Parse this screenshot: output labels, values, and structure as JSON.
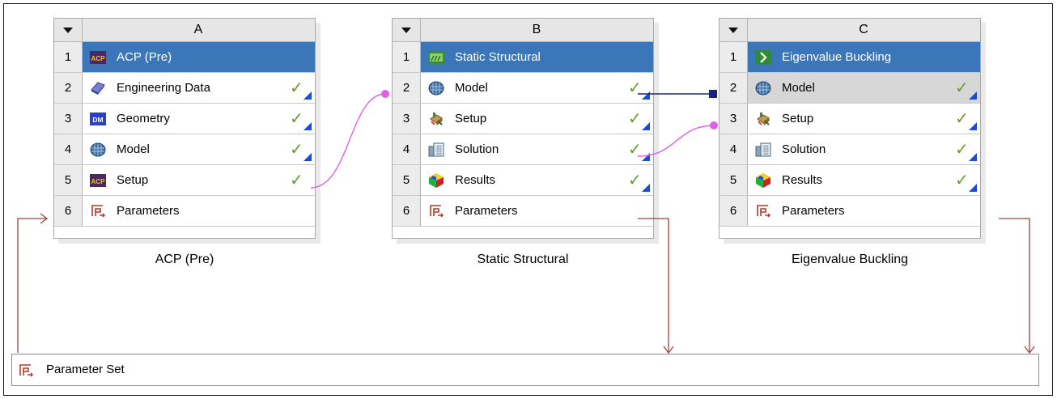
{
  "systems": [
    {
      "letter": "A",
      "name": "ACP (Pre)",
      "rows": [
        {
          "num": "1",
          "icon": "acp-icon",
          "label": "ACP (Pre)",
          "check": "",
          "triangle": false,
          "state": "selected"
        },
        {
          "num": "2",
          "icon": "engineering-data-icon",
          "label": "Engineering Data",
          "check": "✓",
          "triangle": true,
          "state": ""
        },
        {
          "num": "3",
          "icon": "geometry-dm-icon",
          "label": "Geometry",
          "check": "✓",
          "triangle": true,
          "state": ""
        },
        {
          "num": "4",
          "icon": "model-icon",
          "label": "Model",
          "check": "✓",
          "triangle": true,
          "state": ""
        },
        {
          "num": "5",
          "icon": "acp-icon",
          "label": "Setup",
          "check": "✓",
          "triangle": false,
          "state": ""
        },
        {
          "num": "6",
          "icon": "parameters-icon",
          "label": "Parameters",
          "check": "",
          "triangle": false,
          "state": ""
        }
      ]
    },
    {
      "letter": "B",
      "name": "Static Structural",
      "rows": [
        {
          "num": "1",
          "icon": "static-structural-icon",
          "label": "Static Structural",
          "check": "",
          "triangle": false,
          "state": "selected"
        },
        {
          "num": "2",
          "icon": "model-icon",
          "label": "Model",
          "check": "✓",
          "triangle": true,
          "state": ""
        },
        {
          "num": "3",
          "icon": "setup-icon",
          "label": "Setup",
          "check": "✓",
          "triangle": true,
          "state": ""
        },
        {
          "num": "4",
          "icon": "solution-icon",
          "label": "Solution",
          "check": "✓",
          "triangle": true,
          "state": ""
        },
        {
          "num": "5",
          "icon": "results-icon",
          "label": "Results",
          "check": "✓",
          "triangle": true,
          "state": ""
        },
        {
          "num": "6",
          "icon": "parameters-icon",
          "label": "Parameters",
          "check": "",
          "triangle": false,
          "state": ""
        }
      ]
    },
    {
      "letter": "C",
      "name": "Eigenvalue Buckling",
      "rows": [
        {
          "num": "1",
          "icon": "eigenvalue-buckling-icon",
          "label": "Eigenvalue Buckling",
          "check": "",
          "triangle": false,
          "state": "selected"
        },
        {
          "num": "2",
          "icon": "model-icon",
          "label": "Model",
          "check": "✓",
          "triangle": true,
          "state": "shared"
        },
        {
          "num": "3",
          "icon": "setup-icon",
          "label": "Setup",
          "check": "✓",
          "triangle": true,
          "state": ""
        },
        {
          "num": "4",
          "icon": "solution-icon",
          "label": "Solution",
          "check": "✓",
          "triangle": true,
          "state": ""
        },
        {
          "num": "5",
          "icon": "results-icon",
          "label": "Results",
          "check": "✓",
          "triangle": true,
          "state": ""
        },
        {
          "num": "6",
          "icon": "parameters-icon",
          "label": "Parameters",
          "check": "",
          "triangle": false,
          "state": ""
        }
      ]
    }
  ],
  "parameter_set": {
    "icon": "parameters-icon",
    "label": "Parameter Set"
  },
  "colors": {
    "selected_row": "#3b76b8",
    "shared_row": "#d7d7d7",
    "check": "#6a9a2a",
    "triangle": "#1f4bd1",
    "data_link": "#e060e8",
    "share_link": "#1a237e",
    "parameter_link": "#a34040"
  }
}
